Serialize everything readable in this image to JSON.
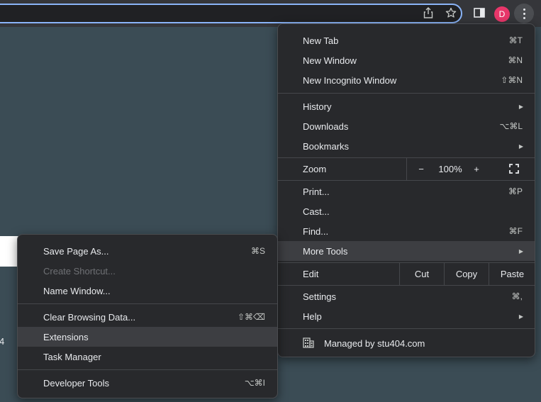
{
  "toolbar": {
    "avatar_letter": "D",
    "icons": [
      "share-icon",
      "star-icon",
      "side-panel-icon",
      "more-menu-icon"
    ]
  },
  "page": {
    "stray_text": "4"
  },
  "main_menu": {
    "new_tab": {
      "label": "New Tab",
      "shortcut": "⌘T"
    },
    "new_window": {
      "label": "New Window",
      "shortcut": "⌘N"
    },
    "new_incognito": {
      "label": "New Incognito Window",
      "shortcut": "⇧⌘N"
    },
    "history": {
      "label": "History"
    },
    "downloads": {
      "label": "Downloads",
      "shortcut": "⌥⌘L"
    },
    "bookmarks": {
      "label": "Bookmarks"
    },
    "zoom": {
      "label": "Zoom",
      "minus": "−",
      "value": "100%",
      "plus": "+"
    },
    "print": {
      "label": "Print...",
      "shortcut": "⌘P"
    },
    "cast": {
      "label": "Cast..."
    },
    "find": {
      "label": "Find...",
      "shortcut": "⌘F"
    },
    "more_tools": {
      "label": "More Tools"
    },
    "edit": {
      "label": "Edit",
      "cut": "Cut",
      "copy": "Copy",
      "paste": "Paste"
    },
    "settings": {
      "label": "Settings",
      "shortcut": "⌘,"
    },
    "help": {
      "label": "Help"
    },
    "managed": {
      "label": "Managed by stu404.com"
    }
  },
  "sub_menu": {
    "save_page": {
      "label": "Save Page As...",
      "shortcut": "⌘S"
    },
    "create_shortcut": {
      "label": "Create Shortcut..."
    },
    "name_window": {
      "label": "Name Window..."
    },
    "clear_data": {
      "label": "Clear Browsing Data...",
      "shortcut": "⇧⌘⌫"
    },
    "extensions": {
      "label": "Extensions"
    },
    "task_manager": {
      "label": "Task Manager"
    },
    "dev_tools": {
      "label": "Developer Tools",
      "shortcut": "⌥⌘I"
    }
  },
  "colors": {
    "background": "#3b4c55",
    "menu_bg": "#28292c",
    "hover_bg": "#3d3e42",
    "avatar": "#e8366a",
    "focus_ring": "#8ab4f8"
  }
}
